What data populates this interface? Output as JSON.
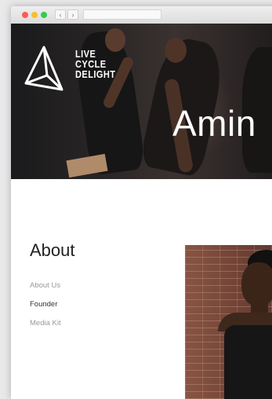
{
  "browser": {
    "back_glyph": "‹",
    "forward_glyph": "›"
  },
  "hero": {
    "logo_lines": [
      "LIVE",
      "CYCLE",
      "DELIGHT"
    ],
    "title": "Amin"
  },
  "about": {
    "heading": "About",
    "nav": [
      {
        "label": "About Us",
        "active": false
      },
      {
        "label": "Founder",
        "active": true
      },
      {
        "label": "Media Kit",
        "active": false
      }
    ]
  },
  "colors": {
    "nav_inactive": "#9a9a9a",
    "nav_active": "#333333",
    "close": "#fc5b57",
    "minimize": "#f8bf2f",
    "zoom": "#35cb4b"
  }
}
